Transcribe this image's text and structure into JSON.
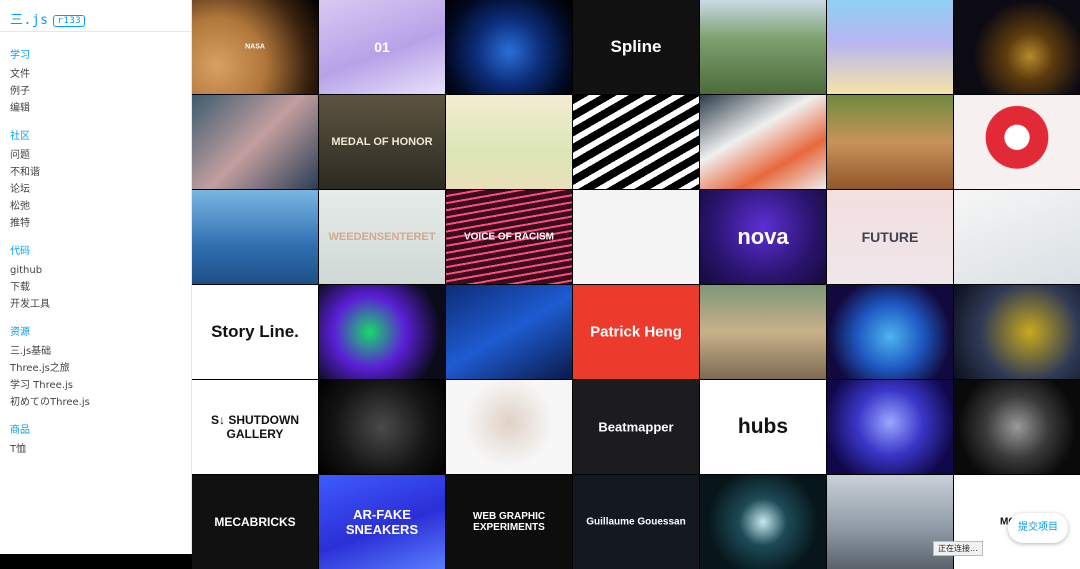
{
  "logo": {
    "text": "三.js",
    "revision": "r133"
  },
  "nav": [
    {
      "title": "学习",
      "items": [
        "文件",
        "例子",
        "编辑"
      ]
    },
    {
      "title": "社区",
      "items": [
        "问题",
        "不和谐",
        "论坛",
        "松弛",
        "推特"
      ]
    },
    {
      "title": "代码",
      "items": [
        "github",
        "下载",
        "开发工具"
      ]
    },
    {
      "title": "资源",
      "items": [
        "三.js基础",
        "Three.js之旅",
        "学习 Three.js",
        "初めてのThree.js"
      ]
    },
    {
      "title": "商品",
      "items": [
        "T恤"
      ]
    }
  ],
  "projects": [
    {
      "bg": "radial-gradient(circle at 20% 70%, #d9a063 0%, #b0763a 40%, #3a220f 75%, #000 100%)",
      "text": "NASA",
      "color": "#fff",
      "size": 7
    },
    {
      "bg": "linear-gradient(160deg,#d8c9f2,#b7a2e8 55%,#e9e1fa)",
      "text": "01",
      "color": "#fff",
      "size": 14
    },
    {
      "bg": "radial-gradient(circle at 50% 55%, #2b6fd8 0%, #0c2d7a 40%, #020a24 75%, #000 100%)",
      "text": "",
      "color": "#fff",
      "size": 10
    },
    {
      "bg": "#111111",
      "text": "Spline",
      "color": "#fff",
      "size": 17
    },
    {
      "bg": "linear-gradient(180deg,#c9dbe6,#7ea271 40%,#4d6b3b)",
      "text": "",
      "color": "#fff",
      "size": 10
    },
    {
      "bg": "linear-gradient(180deg,#8fd0f3,#b7b6f0 45%,#f6e4a8)",
      "text": "",
      "color": "#fff",
      "size": 10
    },
    {
      "bg": "radial-gradient(circle at 60% 60%, #b58a2a 0%, #5e3b0e 25%, #0c0a12 60%)",
      "text": "",
      "color": "#fff",
      "size": 10
    },
    {
      "bg": "linear-gradient(135deg,#3b5b6e,#c39fa0 50%,#2a3e55)",
      "text": "",
      "color": "#fff",
      "size": 10
    },
    {
      "bg": "linear-gradient(180deg,#5c5440,#2d2a22)",
      "text": "MEDAL OF HONOR",
      "color": "#f0e8d0",
      "size": 11
    },
    {
      "bg": "linear-gradient(180deg,#f4ecd2,#dbe6b5 60%,#e9dfb8)",
      "text": "",
      "color": "#fff",
      "size": 10
    },
    {
      "bg": "repeating-linear-gradient(150deg,#000 0 8px,#fff 8px 14px)",
      "text": "",
      "color": "#fff",
      "size": 10
    },
    {
      "bg": "linear-gradient(150deg,#2b3b47,#f0f0f0 40%,#e8683d 70%,#ededed)",
      "text": "",
      "color": "#fff",
      "size": 10
    },
    {
      "bg": "linear-gradient(180deg,#6f8a3e,#c7935a 50%,#93572b)",
      "text": "",
      "color": "#fff",
      "size": 10
    },
    {
      "bg": "radial-gradient(circle at 50% 45%, #ffffff 0%, #ffffff 15%, #e22a36 16%, #e22a36 38%, #f7f0f0 39%)",
      "text": "",
      "color": "#fff",
      "size": 10
    },
    {
      "bg": "linear-gradient(180deg,#7ab6e2,#2f6fb0 60%,#1d4f86)",
      "text": "",
      "color": "#fff",
      "size": 10
    },
    {
      "bg": "linear-gradient(180deg,#e6ece9,#cfd8d4)",
      "text": "WEEDENSENTERET",
      "color": "#d6a98f",
      "size": 11
    },
    {
      "bg": "repeating-linear-gradient(170deg,#3a0c1d 0 5px,#ff4d7a 5px 7px)",
      "text": "VOICE OF RACISM",
      "color": "#fff",
      "size": 10
    },
    {
      "bg": "#f4f4f4",
      "text": "",
      "color": "#111",
      "size": 10
    },
    {
      "bg": "radial-gradient(circle at 50% 40%, #5d2fd6 0%, #2a146e 60%, #150a3a 100%)",
      "text": "nova",
      "color": "#fff",
      "size": 22
    },
    {
      "bg": "linear-gradient(180deg,#f3dfdf,#efe6ea)",
      "text": "FUTURE",
      "color": "#3b4454",
      "size": 14
    },
    {
      "bg": "linear-gradient(160deg,#f6f6f6,#d9e0e4)",
      "text": "",
      "color": "#fff",
      "size": 10
    },
    {
      "bg": "#ffffff",
      "text": "Story Line.",
      "color": "#111",
      "size": 17
    },
    {
      "bg": "radial-gradient(circle at 40% 50%, #18d96a 0%, #5a1fd6 40%, #0a0a18 80%)",
      "text": "",
      "color": "#fff",
      "size": 10
    },
    {
      "bg": "linear-gradient(150deg,#0e2c78,#1e5bd1 50%,#0a1a4a)",
      "text": "",
      "color": "#fff",
      "size": 10
    },
    {
      "bg": "#ec3b2c",
      "text": "Patrick Heng",
      "color": "#fff",
      "size": 15
    },
    {
      "bg": "linear-gradient(180deg,#7e9677,#c8b18a 50%,#7d6a52)",
      "text": "",
      "color": "#fff",
      "size": 10
    },
    {
      "bg": "radial-gradient(circle at 50% 55%, #4eb4f0 0%, #1e58c2 40%, #120a3e 75%)",
      "text": "",
      "color": "#fff",
      "size": 10
    },
    {
      "bg": "radial-gradient(circle at 60% 50%, #c9a91c 0%, #2f3a56 55%, #0b0f1c 100%)",
      "text": "",
      "color": "#fff",
      "size": 10
    },
    {
      "bg": "#ffffff",
      "text": "S↓ SHUTDOWN GALLERY",
      "color": "#111",
      "size": 12
    },
    {
      "bg": "radial-gradient(circle at 50% 50%, #4a4a4a 0%, #141414 60%, #000 100%)",
      "text": "",
      "color": "#fff",
      "size": 10
    },
    {
      "bg": "radial-gradient(circle at 50% 45%, #e0d1c5 0%, #f7f7f7 55%)",
      "text": "",
      "color": "#333",
      "size": 10
    },
    {
      "bg": "#1c1c20",
      "text": "Beatmapper",
      "color": "#fff",
      "size": 13
    },
    {
      "bg": "#ffffff",
      "text": "hubs",
      "color": "#111",
      "size": 21
    },
    {
      "bg": "radial-gradient(circle at 50% 45%, #9aa8ff 0%, #3a36c8 40%, #10084a 80%)",
      "text": "",
      "color": "#fff",
      "size": 10
    },
    {
      "bg": "radial-gradient(circle at 50% 50%, #9a9a9a 0%, #3a3a3a 40%, #0a0a0a 75%)",
      "text": "",
      "color": "#fff",
      "size": 10
    },
    {
      "bg": "#111111",
      "text": "MECABRICKS",
      "color": "#fff",
      "size": 12
    },
    {
      "bg": "linear-gradient(160deg,#3e5bff,#2b2fd6 55%,#5a7dff)",
      "text": "AR-FAKE SNEAKERS",
      "color": "#fff",
      "size": 13
    },
    {
      "bg": "#0d0d0d",
      "text": "WEB GRAPHIC EXPERIMENTS",
      "color": "#fff",
      "size": 10
    },
    {
      "bg": "#141820",
      "text": "Guillaume Gouessan",
      "color": "#fff",
      "size": 10
    },
    {
      "bg": "radial-gradient(circle at 50% 50%, #c7e9ee 0%, #1d4b57 30%, #07161b 70%)",
      "text": "",
      "color": "#fff",
      "size": 10
    },
    {
      "bg": "linear-gradient(180deg,#c9d1d9,#8c97a3 60%,#5a626b)",
      "text": "",
      "color": "#fff",
      "size": 10
    },
    {
      "bg": "#ffffff",
      "text": "MO NO",
      "color": "#111",
      "size": 10
    }
  ],
  "submit_label": "提交项目",
  "status_text": "正在连接..."
}
